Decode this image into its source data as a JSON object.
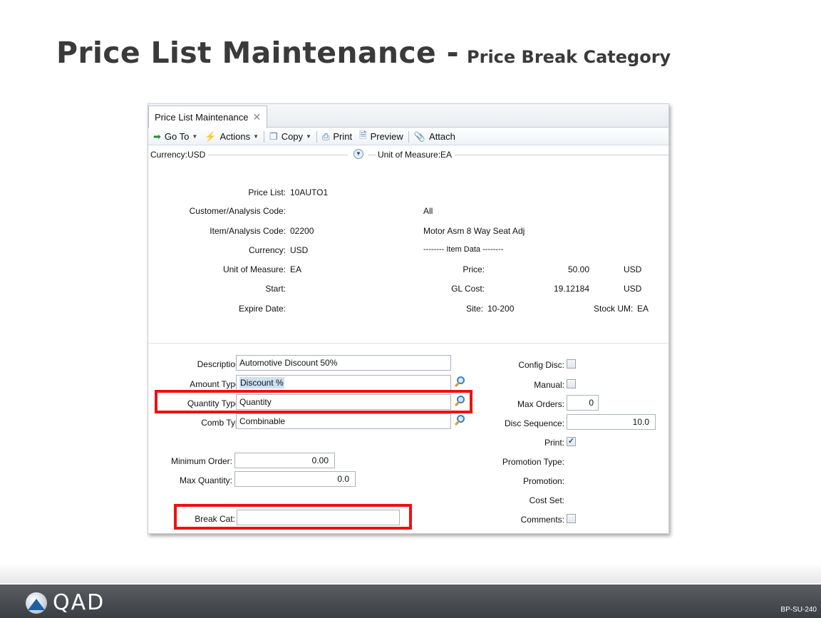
{
  "slide": {
    "title": "Price List Maintenance -",
    "subtitle": "Price Break Category",
    "footer_logo_text": "QAD",
    "footer_code": "BP-SU-240"
  },
  "window": {
    "tab_label": "Price List Maintenance",
    "toolbar": {
      "goto": "Go To",
      "actions": "Actions",
      "copy": "Copy",
      "print": "Print",
      "preview": "Preview",
      "attach": "Attach"
    },
    "summary": {
      "currency": "Currency:USD",
      "uom": "Unit of Measure:EA"
    }
  },
  "header": {
    "price_list_label": "Price List:",
    "price_list_value": "10AUTO1",
    "customer_label": "Customer/Analysis Code:",
    "customer_value": "All",
    "item_label": "Item/Analysis Code:",
    "item_value": "02200",
    "item_desc": "Motor Asm 8 Way Seat Adj",
    "currency_label": "Currency:",
    "currency_value": "USD",
    "item_data_heading": "-------- Item Data --------",
    "uom_label": "Unit of Measure:",
    "uom_value": "EA",
    "price_label": "Price:",
    "price_value": "50.00",
    "price_curr": "USD",
    "start_label": "Start:",
    "glcost_label": "GL Cost:",
    "glcost_value": "19.12184",
    "glcost_curr": "USD",
    "expire_label": "Expire Date:",
    "site_label": "Site:",
    "site_value": "10-200",
    "stock_um_label": "Stock UM:",
    "stock_um_value": "EA"
  },
  "detail": {
    "description_label": "Description:",
    "description_value": "Automotive Discount 50%",
    "amount_type_label": "Amount Type:",
    "amount_type_value": "Discount %",
    "quantity_type_label": "Quantity Type:",
    "quantity_type_value": "Quantity",
    "comb_typ_label": "Comb Typ:",
    "comb_typ_value": "Combinable",
    "min_order_label": "Minimum Order:",
    "min_order_value": "0.00",
    "max_qty_label": "Max Quantity:",
    "max_qty_value": "0.0",
    "break_cat_label": "Break Cat:",
    "break_cat_value": "",
    "config_disc_label": "Config Disc:",
    "config_disc_checked": false,
    "manual_label": "Manual:",
    "manual_checked": false,
    "max_orders_label": "Max Orders:",
    "max_orders_value": "0",
    "disc_seq_label": "Disc Sequence:",
    "disc_seq_value": "10.0",
    "print_label": "Print:",
    "print_checked": true,
    "promo_type_label": "Promotion Type:",
    "promotion_label": "Promotion:",
    "cost_set_label": "Cost Set:",
    "comments_label": "Comments:",
    "comments_checked": false
  },
  "icons": {
    "goto": "arrow-go-icon",
    "actions": "lightning-icon",
    "copy": "copy-icon",
    "print": "printer-icon",
    "preview": "preview-icon",
    "attach": "paperclip-icon",
    "lookup": "magnifier-icon",
    "expand": "chevron-down-icon"
  },
  "colors": {
    "highlight_box": "#ee1111",
    "title_text": "#3a3a3a",
    "footer_bg": "#4a4d51"
  }
}
